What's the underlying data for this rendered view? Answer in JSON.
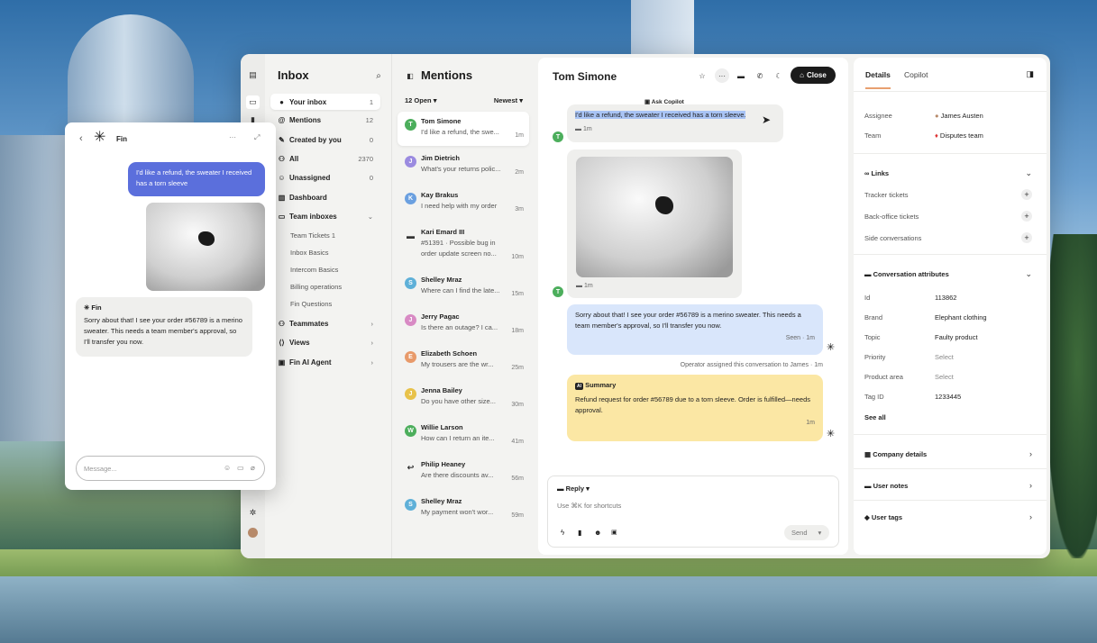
{
  "rail": {
    "icons": [
      "panel-icon",
      "inbox-icon",
      "book-icon",
      "settings-icon",
      "avatar-icon"
    ]
  },
  "inbox": {
    "title": "Inbox",
    "items": [
      {
        "label": "Your inbox",
        "count": "1"
      },
      {
        "label": "Mentions",
        "count": "12"
      },
      {
        "label": "Created by you",
        "count": "0"
      },
      {
        "label": "All",
        "count": "2370"
      },
      {
        "label": "Unassigned",
        "count": "0"
      },
      {
        "label": "Dashboard",
        "count": ""
      },
      {
        "label": "Team inboxes",
        "count": ""
      }
    ],
    "team_inboxes": [
      "Team Tickets 1",
      "Inbox Basics",
      "Intercom Basics",
      "Billing operations",
      "Fin Questions"
    ],
    "bottom": [
      "Teammates",
      "Views",
      "Fin AI Agent"
    ]
  },
  "mentions": {
    "title": "Mentions",
    "filter": "12 Open",
    "sort": "Newest",
    "items": [
      {
        "initial": "T",
        "name": "Tom Simone",
        "preview": "I'd like a refund, the swe...",
        "time": "1m",
        "color": "#4cae5c"
      },
      {
        "initial": "J",
        "name": "Jim Dietrich",
        "preview": "What's your returns polic...",
        "time": "2m",
        "color": "#9b8be0"
      },
      {
        "initial": "K",
        "name": "Kay Brakus",
        "preview": "I need help with my order",
        "time": "3m",
        "color": "#6ba0e0"
      },
      {
        "initial": "",
        "name": "Kari Emard III",
        "preview": "#51391 · Possible bug in",
        "preview2": "order update screen no...",
        "time": "10m",
        "color": "#333333"
      },
      {
        "initial": "S",
        "name": "Shelley Mraz",
        "preview": "Where can I find the late...",
        "time": "15m",
        "color": "#5fb0d8"
      },
      {
        "initial": "J",
        "name": "Jerry Pagac",
        "preview": "Is there an outage? I ca...",
        "time": "18m",
        "color": "#d88ac4"
      },
      {
        "initial": "E",
        "name": "Elizabeth Schoen",
        "preview": "My trousers are the wr...",
        "time": "25m",
        "color": "#e89a6a"
      },
      {
        "initial": "J",
        "name": "Jenna Bailey",
        "preview": "Do you have other size...",
        "time": "30m",
        "color": "#e8c24a"
      },
      {
        "initial": "W",
        "name": "Willie Larson",
        "preview": "How can I return an ite...",
        "time": "41m",
        "color": "#4cae5c"
      },
      {
        "initial": "",
        "name": "Philip Heaney",
        "preview": "Are there discounts av...",
        "time": "56m",
        "color": "#555555"
      },
      {
        "initial": "S",
        "name": "Shelley Mraz",
        "preview": "My payment won't wor...",
        "time": "59m",
        "color": "#5fb0d8"
      }
    ]
  },
  "conversation": {
    "title": "Tom Simone",
    "close_label": "Close",
    "ask_copilot": "Ask Copilot",
    "msg1": "I'd like a refund, the sweater I received has a torn sleeve.",
    "msg1_time": "1m",
    "img_time": "1m",
    "reply": "Sorry about that! I see your order #56789 is a merino sweater. This needs a team member's approval, so I'll transfer you now.",
    "reply_meta": "Seen · 1m",
    "assign_note": "Operator assigned this conversation to James · 1m",
    "summary_title": "Summary",
    "summary_text": "Refund request for order #56789 due to a torn sleeve. Order is fulfilled—needs approval.",
    "summary_time": "1m",
    "reply_mode": "Reply",
    "composer_placeholder": "Use ⌘K for shortcuts",
    "send_label": "Send"
  },
  "details": {
    "tabs": [
      "Details",
      "Copilot"
    ],
    "assignee_label": "Assignee",
    "assignee": "James Austen",
    "team_label": "Team",
    "team": "Disputes team",
    "links_title": "Links",
    "links": [
      "Tracker tickets",
      "Back-office tickets",
      "Side conversations"
    ],
    "attrs_title": "Conversation attributes",
    "attrs": [
      {
        "k": "Id",
        "v": "113862"
      },
      {
        "k": "Brand",
        "v": "Elephant clothing"
      },
      {
        "k": "Topic",
        "v": "Faulty product"
      },
      {
        "k": "Priority",
        "v": "Select"
      },
      {
        "k": "Product area",
        "v": "Select"
      },
      {
        "k": "Tag ID",
        "v": "1233445"
      }
    ],
    "see_all": "See all",
    "sections": [
      "Company details",
      "User notes",
      "User tags"
    ]
  },
  "fin": {
    "title": "Fin",
    "user_msg": "I'd like a refund, the sweater I received has a torn sleeve",
    "bot_name": "Fin",
    "bot_msg": "Sorry about that! I see your order #56789 is a merino sweater. This needs a team member's approval, so I'll transfer you now.",
    "placeholder": "Message..."
  },
  "colors": {
    "accent_blue": "#5b6fdc",
    "summary_yellow": "#fbe7a4",
    "reply_blue": "#d9e6fb",
    "close_black": "#1b1b1b"
  }
}
